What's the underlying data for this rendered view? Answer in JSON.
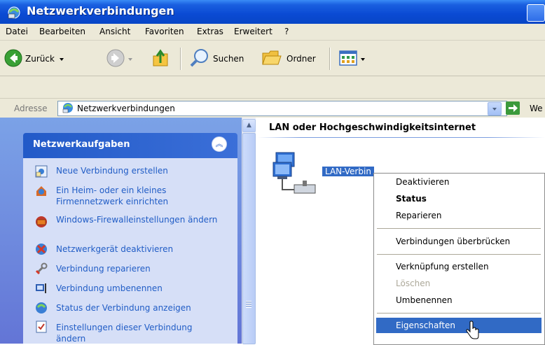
{
  "window": {
    "title": "Netzwerkverbindungen",
    "accent": "#0a4ad3"
  },
  "menu": [
    "Datei",
    "Bearbeiten",
    "Ansicht",
    "Favoriten",
    "Extras",
    "Erweitert",
    "?"
  ],
  "toolbar": {
    "back_label": "Zurück",
    "search_label": "Suchen",
    "folders_label": "Ordner"
  },
  "address": {
    "label": "Adresse",
    "value": "Netzwerkverbindungen",
    "go_label": "We"
  },
  "tasks": {
    "title": "Netzwerkaufgaben",
    "items": [
      {
        "label": "Neue Verbindung erstellen",
        "icon": "new-connection-icon"
      },
      {
        "label": "Ein Heim- oder ein kleines Firmennetzwerk einrichten",
        "icon": "home-network-icon"
      },
      {
        "label": "Windows-Firewalleinstellungen ändern",
        "icon": "firewall-icon"
      },
      {
        "label": "Netzwerkgerät deaktivieren",
        "icon": "disable-device-icon"
      },
      {
        "label": "Verbindung reparieren",
        "icon": "repair-icon"
      },
      {
        "label": "Verbindung umbenennen",
        "icon": "rename-icon"
      },
      {
        "label": "Status der Verbindung anzeigen",
        "icon": "status-icon"
      },
      {
        "label": "Einstellungen dieser Verbindung ändern",
        "icon": "settings-icon"
      }
    ]
  },
  "content": {
    "group_header": "LAN oder Hochgeschwindigkeitsinternet",
    "connection_label": "LAN-Verbin"
  },
  "context_menu": {
    "items": [
      {
        "label": "Deaktivieren",
        "bold": false,
        "disabled": false
      },
      {
        "label": "Status",
        "bold": true,
        "disabled": false
      },
      {
        "label": "Reparieren",
        "bold": false,
        "disabled": false
      },
      {
        "label": "Verbindungen überbrücken",
        "bold": false,
        "disabled": false
      },
      {
        "label": "Verknüpfung erstellen",
        "bold": false,
        "disabled": false
      },
      {
        "label": "Löschen",
        "bold": false,
        "disabled": true
      },
      {
        "label": "Umbenennen",
        "bold": false,
        "disabled": false
      },
      {
        "label": "Eigenschaften",
        "bold": false,
        "disabled": false,
        "highlighted": true
      }
    ],
    "highlight_color": "#316ac5"
  }
}
